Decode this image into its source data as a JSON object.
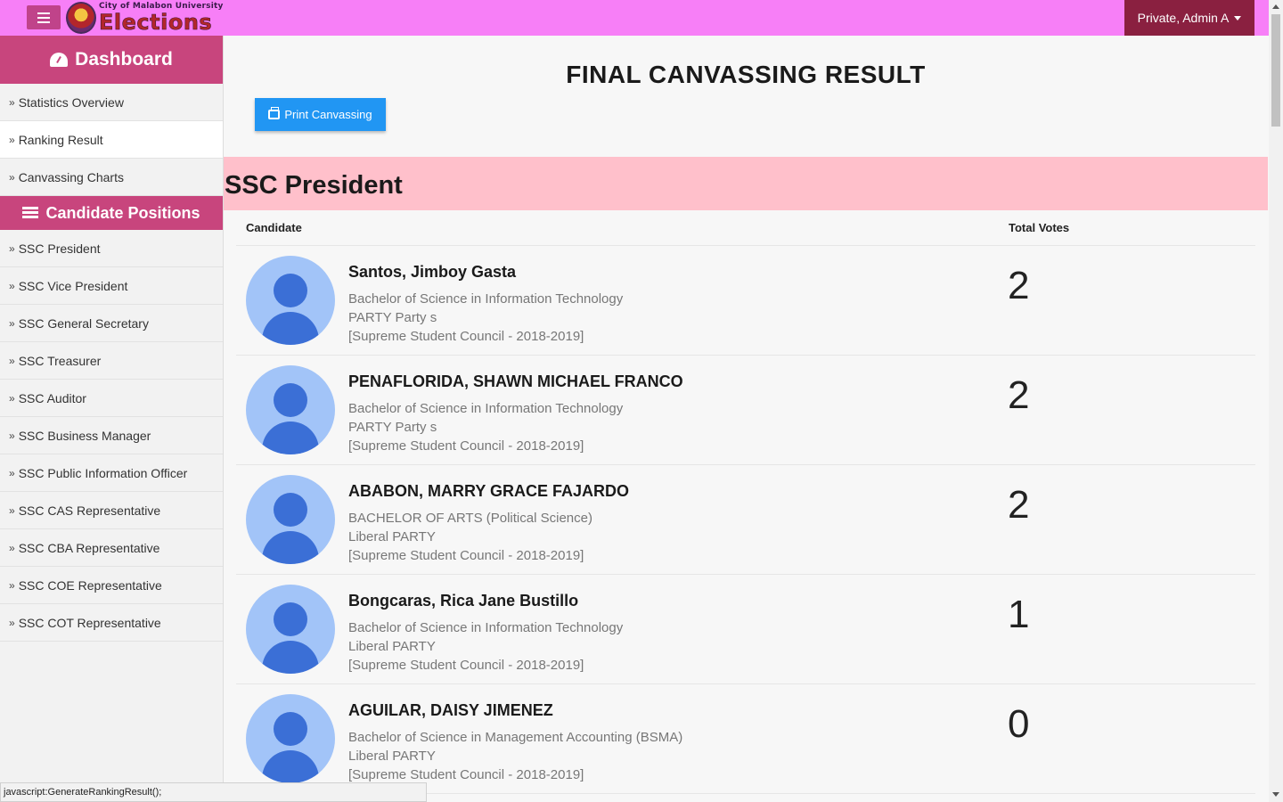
{
  "header": {
    "logo_sub": "City of Malabon University",
    "logo_main": "Elections",
    "user_menu": "Private, Admin A"
  },
  "sidebar": {
    "dashboard_heading": "Dashboard",
    "dashboard_items": [
      {
        "label": "Statistics Overview"
      },
      {
        "label": "Ranking Result"
      },
      {
        "label": "Canvassing Charts"
      }
    ],
    "positions_heading": "Candidate Positions",
    "position_items": [
      {
        "label": "SSC President"
      },
      {
        "label": "SSC Vice President"
      },
      {
        "label": "SSC General Secretary"
      },
      {
        "label": "SSC Treasurer"
      },
      {
        "label": "SSC Auditor"
      },
      {
        "label": "SSC Business Manager"
      },
      {
        "label": "SSC Public Information Officer"
      },
      {
        "label": "SSC CAS Representative"
      },
      {
        "label": "SSC CBA Representative"
      },
      {
        "label": "SSC COE Representative"
      },
      {
        "label": "SSC COT Representative"
      }
    ]
  },
  "main": {
    "title": "FINAL CANVASSING RESULT",
    "print_button": "Print Canvassing",
    "section_title": "SSC President",
    "table_headers": {
      "candidate": "Candidate",
      "votes": "Total Votes"
    },
    "candidates": [
      {
        "name": "Santos, Jimboy Gasta",
        "course": "Bachelor of Science in Information Technology",
        "party": "PARTY Party s",
        "council": "[Supreme Student Council - 2018-2019]",
        "votes": "2"
      },
      {
        "name": "PENAFLORIDA, SHAWN MICHAEL FRANCO",
        "course": "Bachelor of Science in Information Technology",
        "party": "PARTY Party s",
        "council": "[Supreme Student Council - 2018-2019]",
        "votes": "2"
      },
      {
        "name": "ABABON, MARRY GRACE FAJARDO",
        "course": "BACHELOR OF ARTS (Political Science)",
        "party": "Liberal PARTY",
        "council": "[Supreme Student Council - 2018-2019]",
        "votes": "2"
      },
      {
        "name": "Bongcaras, Rica Jane Bustillo",
        "course": "Bachelor of Science in Information Technology",
        "party": "Liberal PARTY",
        "council": "[Supreme Student Council - 2018-2019]",
        "votes": "1"
      },
      {
        "name": "AGUILAR, DAISY JIMENEZ",
        "course": "Bachelor of Science in Management Accounting (BSMA)",
        "party": "Liberal PARTY",
        "council": "[Supreme Student Council - 2018-2019]",
        "votes": "0"
      }
    ]
  },
  "status_bar": "javascript:GenerateRankingResult();",
  "colors": {
    "topbar": "#f77ff7",
    "sidebar_heading": "#c8457d",
    "user_menu": "#8a2040",
    "section_bar": "#ffc0cb",
    "print_button": "#2196f3"
  }
}
